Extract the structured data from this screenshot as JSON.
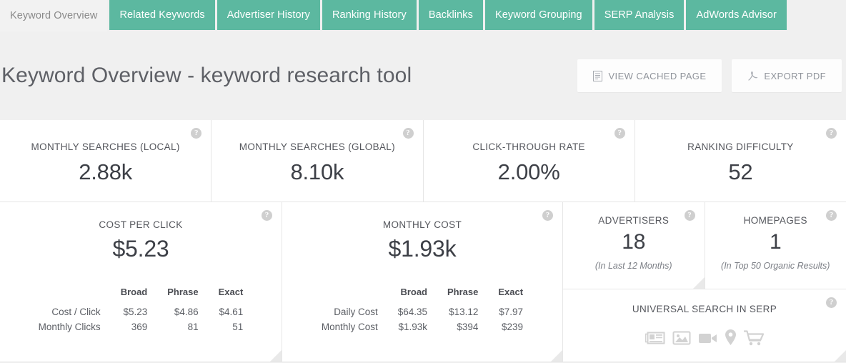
{
  "tabs": [
    {
      "label": "Keyword Overview",
      "active": true
    },
    {
      "label": "Related Keywords",
      "active": false
    },
    {
      "label": "Advertiser History",
      "active": false
    },
    {
      "label": "Ranking History",
      "active": false
    },
    {
      "label": "Backlinks",
      "active": false
    },
    {
      "label": "Keyword Grouping",
      "active": false
    },
    {
      "label": "SERP Analysis",
      "active": false
    },
    {
      "label": "AdWords Advisor",
      "active": false
    }
  ],
  "header": {
    "title": "Keyword Overview - keyword research tool",
    "buttons": [
      {
        "label": "VIEW CACHED PAGE",
        "icon": "document-icon"
      },
      {
        "label": "EXPORT PDF",
        "icon": "pdf-icon"
      }
    ]
  },
  "metrics_row1": [
    {
      "label": "MONTHLY SEARCHES (LOCAL)",
      "value": "2.88k",
      "help": "?"
    },
    {
      "label": "MONTHLY SEARCHES (GLOBAL)",
      "value": "8.10k",
      "help": "?"
    },
    {
      "label": "CLICK-THROUGH RATE",
      "value": "2.00%",
      "help": "?"
    },
    {
      "label": "RANKING DIFFICULTY",
      "value": "52",
      "help": "?"
    }
  ],
  "cost_per_click": {
    "label": "COST PER CLICK",
    "value": "$5.23",
    "help": "?",
    "columns": [
      "Broad",
      "Phrase",
      "Exact"
    ],
    "rows": [
      {
        "name": "Cost / Click",
        "values": [
          "$5.23",
          "$4.86",
          "$4.61"
        ]
      },
      {
        "name": "Monthly Clicks",
        "values": [
          "369",
          "81",
          "51"
        ]
      }
    ]
  },
  "monthly_cost": {
    "label": "MONTHLY COST",
    "value": "$1.93k",
    "help": "?",
    "columns": [
      "Broad",
      "Phrase",
      "Exact"
    ],
    "rows": [
      {
        "name": "Daily Cost",
        "values": [
          "$64.35",
          "$13.12",
          "$7.97"
        ]
      },
      {
        "name": "Monthly Cost",
        "values": [
          "$1.93k",
          "$394",
          "$239"
        ]
      }
    ]
  },
  "advertisers": {
    "label": "ADVERTISERS",
    "value": "18",
    "sub": "(In Last 12 Months)",
    "help": "?"
  },
  "homepages": {
    "label": "HOMEPAGES",
    "value": "1",
    "sub": "(In Top 50 Organic Results)",
    "help": "?"
  },
  "universal_search": {
    "label": "UNIVERSAL SEARCH IN SERP",
    "help": "?",
    "icons": [
      "news-icon",
      "image-icon",
      "video-icon",
      "map-marker-icon",
      "shopping-cart-icon"
    ]
  },
  "colors": {
    "tab_teal": "#5cb8a0",
    "page_bg": "#f0f0f0",
    "card_bg": "#ffffff",
    "text_dark": "#3d4047",
    "text_muted": "#8a8a8a",
    "icon_gray": "#d2d2d2"
  }
}
